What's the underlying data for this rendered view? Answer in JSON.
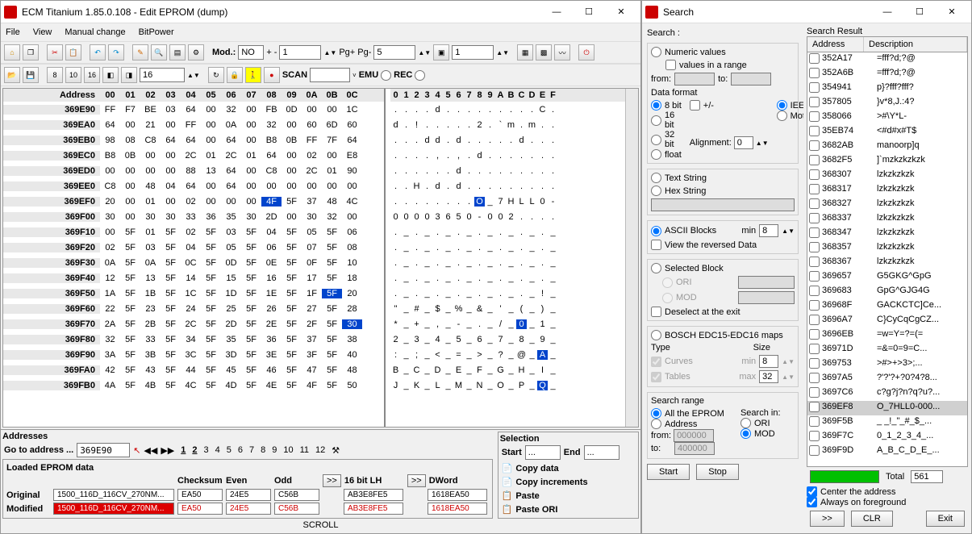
{
  "main": {
    "title": "ECM Titanium 1.85.0.108 - Edit EPROM (dump)",
    "menu": [
      "File",
      "View",
      "Manual change",
      "BitPower"
    ],
    "toolbar1": {
      "mod_label": "Mod.:",
      "mod_value": "NO",
      "plusminus": "+ -",
      "pm_value": "1",
      "pg_label": "Pg+ Pg-",
      "pg_value": "5",
      "sel_value": "1"
    },
    "toolbar2": {
      "width_value": "16",
      "scan_label": "SCAN",
      "emu_label": "EMU",
      "rec_label": "REC"
    },
    "hex": {
      "header_addr": "Address",
      "cols": [
        "00",
        "01",
        "02",
        "03",
        "04",
        "05",
        "06",
        "07",
        "08",
        "09",
        "0A",
        "0B",
        "0C"
      ],
      "ascii_cols": [
        "0",
        "1",
        "2",
        "3",
        "4",
        "5",
        "6",
        "7",
        "8",
        "9",
        "A",
        "B",
        "C",
        "D",
        "E",
        "F"
      ],
      "rows": [
        {
          "addr": "369E90",
          "b": [
            "FF",
            "F7",
            "BE",
            "03",
            "64",
            "00",
            "32",
            "00",
            "FB",
            "0D",
            "00",
            "00",
            "1C"
          ],
          "a": [
            "",
            "",
            "",
            "",
            "d",
            "",
            ".",
            "",
            "",
            "",
            "",
            "",
            "",
            "",
            "C",
            ""
          ]
        },
        {
          "addr": "369EA0",
          "b": [
            "64",
            "00",
            "21",
            "00",
            "FF",
            "00",
            "0A",
            "00",
            "32",
            "00",
            "60",
            "6D",
            "60"
          ],
          "a": [
            "d",
            "",
            "!",
            "",
            "",
            "",
            "",
            "",
            "2",
            "",
            "`",
            "m",
            "",
            "m",
            "",
            ""
          ]
        },
        {
          "addr": "369EB0",
          "b": [
            "98",
            "08",
            "C8",
            "64",
            "64",
            "00",
            "64",
            "00",
            "B8",
            "0B",
            "FF",
            "7F",
            "64"
          ],
          "a": [
            "",
            "",
            "",
            "d",
            "d",
            "",
            "d",
            "",
            "",
            "",
            "",
            "",
            "d",
            "",
            "",
            ""
          ]
        },
        {
          "addr": "369EC0",
          "b": [
            "B8",
            "0B",
            "00",
            "00",
            "2C",
            "01",
            "2C",
            "01",
            "64",
            "00",
            "02",
            "00",
            "E8"
          ],
          "a": [
            "",
            "",
            "",
            "",
            ",",
            "",
            ",",
            "",
            "d",
            "",
            "",
            "",
            "",
            "",
            "",
            ""
          ]
        },
        {
          "addr": "369ED0",
          "b": [
            "00",
            "00",
            "00",
            "00",
            "88",
            "13",
            "64",
            "00",
            "C8",
            "00",
            "2C",
            "01",
            "90"
          ],
          "a": [
            "",
            "",
            "",
            "",
            "",
            "",
            "d",
            "",
            "",
            "",
            "",
            "",
            "",
            "",
            "",
            ""
          ]
        },
        {
          "addr": "369EE0",
          "b": [
            "C8",
            "00",
            "48",
            "04",
            "64",
            "00",
            "64",
            "00",
            "00",
            "00",
            "00",
            "00",
            "00"
          ],
          "a": [
            "",
            "",
            "H",
            "",
            "d",
            "",
            "d",
            "",
            "",
            "",
            "",
            "",
            "",
            "",
            "",
            ""
          ]
        },
        {
          "addr": "369EF0",
          "b": [
            "20",
            "00",
            "01",
            "00",
            "02",
            "00",
            "00",
            "00",
            "4F",
            "5F",
            "37",
            "48",
            "4C"
          ],
          "a": [
            "",
            "",
            "",
            "",
            "",
            "",
            "",
            "",
            "O",
            "_",
            "7",
            "H",
            "L",
            "L",
            "0",
            "-"
          ],
          "sel_hex": 8,
          "sel_ascii": 8
        },
        {
          "addr": "369F00",
          "b": [
            "30",
            "00",
            "30",
            "30",
            "33",
            "36",
            "35",
            "30",
            "2D",
            "00",
            "30",
            "32",
            "00"
          ],
          "a": [
            "0",
            "0",
            "0",
            "0",
            "3",
            "6",
            "5",
            "0",
            "-",
            "0",
            "0",
            "2",
            "",
            "",
            "",
            ""
          ]
        },
        {
          "addr": "369F10",
          "b": [
            "00",
            "5F",
            "01",
            "5F",
            "02",
            "5F",
            "03",
            "5F",
            "04",
            "5F",
            "05",
            "5F",
            "06"
          ],
          "a": [
            "",
            "_",
            "",
            "_",
            "",
            "_",
            "",
            "_",
            "",
            "_",
            "",
            "_",
            "",
            "_",
            "",
            "_"
          ]
        },
        {
          "addr": "369F20",
          "b": [
            "02",
            "5F",
            "03",
            "5F",
            "04",
            "5F",
            "05",
            "5F",
            "06",
            "5F",
            "07",
            "5F",
            "08"
          ],
          "a": [
            "",
            "_",
            "",
            "_",
            "",
            "_",
            "",
            "_",
            "",
            "_",
            "",
            "_",
            "",
            "_",
            "",
            "_"
          ]
        },
        {
          "addr": "369F30",
          "b": [
            "0A",
            "5F",
            "0A",
            "5F",
            "0C",
            "5F",
            "0D",
            "5F",
            "0E",
            "5F",
            "0F",
            "5F",
            "10"
          ],
          "a": [
            "",
            "_",
            "",
            "_",
            "",
            "_",
            "",
            "_",
            "",
            "_",
            "",
            "_",
            "",
            "_",
            "",
            "_"
          ]
        },
        {
          "addr": "369F40",
          "b": [
            "12",
            "5F",
            "13",
            "5F",
            "14",
            "5F",
            "15",
            "5F",
            "16",
            "5F",
            "17",
            "5F",
            "18"
          ],
          "a": [
            "",
            "_",
            "",
            "_",
            "",
            "_",
            "",
            "_",
            "",
            "_",
            "",
            "_",
            "",
            "_",
            "",
            "_"
          ]
        },
        {
          "addr": "369F50",
          "b": [
            "1A",
            "5F",
            "1B",
            "5F",
            "1C",
            "5F",
            "1D",
            "5F",
            "1E",
            "5F",
            "1F",
            "5F",
            "20"
          ],
          "a": [
            "",
            "_",
            "",
            "_",
            "",
            "_",
            "",
            "_",
            "",
            "_",
            "",
            "_",
            "",
            "_",
            "!",
            "_"
          ],
          "sel_hex": 11
        },
        {
          "addr": "369F60",
          "b": [
            "22",
            "5F",
            "23",
            "5F",
            "24",
            "5F",
            "25",
            "5F",
            "26",
            "5F",
            "27",
            "5F",
            "28"
          ],
          "a": [
            "\"",
            "_",
            "#",
            "_",
            "$",
            "_",
            "%",
            "_",
            "&",
            "_",
            "'",
            "_",
            "(",
            "_",
            ")",
            "_"
          ]
        },
        {
          "addr": "369F70",
          "b": [
            "2A",
            "5F",
            "2B",
            "5F",
            "2C",
            "5F",
            "2D",
            "5F",
            "2E",
            "5F",
            "2F",
            "5F",
            "30"
          ],
          "a": [
            "*",
            "_",
            "+",
            "_",
            ",",
            "_",
            "-",
            "_",
            ".",
            "_",
            "/",
            "_",
            "0",
            "_",
            "1",
            "_"
          ],
          "sel_hex": 12,
          "sel_ascii": 12
        },
        {
          "addr": "369F80",
          "b": [
            "32",
            "5F",
            "33",
            "5F",
            "34",
            "5F",
            "35",
            "5F",
            "36",
            "5F",
            "37",
            "5F",
            "38"
          ],
          "a": [
            "2",
            "_",
            "3",
            "_",
            "4",
            "_",
            "5",
            "_",
            "6",
            "_",
            "7",
            "_",
            "8",
            "_",
            "9",
            "_"
          ]
        },
        {
          "addr": "369F90",
          "b": [
            "3A",
            "5F",
            "3B",
            "5F",
            "3C",
            "5F",
            "3D",
            "5F",
            "3E",
            "5F",
            "3F",
            "5F",
            "40"
          ],
          "a": [
            ":",
            "_",
            ";",
            "_",
            "<",
            "_",
            "=",
            "_",
            ">",
            "_",
            "?",
            "_",
            "@",
            "_",
            "A",
            "_"
          ],
          "sel_ascii": 14
        },
        {
          "addr": "369FA0",
          "b": [
            "42",
            "5F",
            "43",
            "5F",
            "44",
            "5F",
            "45",
            "5F",
            "46",
            "5F",
            "47",
            "5F",
            "48"
          ],
          "a": [
            "B",
            "_",
            "C",
            "_",
            "D",
            "_",
            "E",
            "_",
            "F",
            "_",
            "G",
            "_",
            "H",
            "_",
            "I",
            "_"
          ]
        },
        {
          "addr": "369FB0",
          "b": [
            "4A",
            "5F",
            "4B",
            "5F",
            "4C",
            "5F",
            "4D",
            "5F",
            "4E",
            "5F",
            "4F",
            "5F",
            "50"
          ],
          "a": [
            "J",
            "_",
            "K",
            "_",
            "L",
            "_",
            "M",
            "_",
            "N",
            "_",
            "O",
            "_",
            "P",
            "_",
            "Q",
            "_"
          ],
          "sel_ascii": 14
        }
      ]
    },
    "addresses_panel": {
      "title": "Addresses",
      "goto_label": "Go to address ...",
      "goto_value": "369E90",
      "pages": [
        "1",
        "2",
        "3",
        "4",
        "5",
        "6",
        "7",
        "8",
        "9",
        "10",
        "11",
        "12"
      ]
    },
    "eprom": {
      "title": "Loaded EPROM data",
      "headers": [
        "",
        "",
        "Checksum",
        "Even",
        "Odd",
        "",
        "16 bit LH",
        "",
        "DWord"
      ],
      "arrow": ">>",
      "original_lbl": "Original",
      "modified_lbl": "Modified",
      "name": "1500_116D_116CV_270NM...",
      "checksum": "EA50",
      "even": "24E5",
      "odd": "C56B",
      "lh": "AB3E8FE5",
      "dword": "1618EA50"
    },
    "selection": {
      "title": "Selection",
      "start_lbl": "Start",
      "start_val": "...",
      "end_lbl": "End",
      "end_val": "...",
      "copy_data": "Copy data",
      "copy_inc": "Copy increments",
      "paste": "Paste",
      "paste_ori": "Paste ORI"
    },
    "status": "SCROLL"
  },
  "search": {
    "title": "Search",
    "search_lbl": "Search :",
    "numeric": "Numeric values",
    "values_range": "values in a range",
    "from_lbl": "from:",
    "to_lbl": "to:",
    "data_format_lbl": "Data format",
    "fmt_8": "8 bit",
    "fmt_16": "16 bit",
    "fmt_32": "32 bit",
    "fmt_float": "float",
    "fmt_pm": "+/-",
    "fmt_ieee": "IEEE",
    "fmt_mot": "Motorola",
    "align_lbl": "Alignment:",
    "align_val": "0",
    "text_string": "Text String",
    "hex_string": "Hex String",
    "ascii_blocks": "ASCII Blocks",
    "min_lbl": "min",
    "min_val": "8",
    "view_reversed": "View the reversed Data",
    "selected_block": "Selected Block",
    "ori": "ORI",
    "mod": "MOD",
    "deselect": "Deselect at the exit",
    "bosch": "BOSCH EDC15-EDC16 maps",
    "type_lbl": "Type",
    "size_lbl": "Size",
    "curves": "Curves",
    "tables": "Tables",
    "size_min": "8",
    "max_lbl": "max",
    "size_max": "32",
    "range_lbl": "Search range",
    "all_eprom": "All the EPROM",
    "address_r": "Address",
    "r_from": "000000",
    "r_to": "400000",
    "search_in_lbl": "Search in:",
    "start_btn": "Start",
    "stop_btn": "Stop",
    "result_title": "Search Result",
    "col_addr": "Address",
    "col_desc": "Description",
    "results": [
      {
        "a": "352A17",
        "d": "=fff?d;?@"
      },
      {
        "a": "352A6B",
        "d": "=fff?d;?@"
      },
      {
        "a": "354941",
        "d": "p}?fff?fff?"
      },
      {
        "a": "357805",
        "d": "}v*8,J.:4?"
      },
      {
        "a": "358066",
        "d": ">#\\Y*L-"
      },
      {
        "a": "35EB74",
        "d": "<#d#x#T$"
      },
      {
        "a": "3682AB",
        "d": "manoorp]q"
      },
      {
        "a": "3682F5",
        "d": "]`mzkzkzkzk"
      },
      {
        "a": "368307",
        "d": "lzkzkzkzk"
      },
      {
        "a": "368317",
        "d": "lzkzkzkzk"
      },
      {
        "a": "368327",
        "d": "lzkzkzkzk"
      },
      {
        "a": "368337",
        "d": "lzkzkzkzk"
      },
      {
        "a": "368347",
        "d": "lzkzkzkzk"
      },
      {
        "a": "368357",
        "d": "lzkzkzkzk"
      },
      {
        "a": "368367",
        "d": "lzkzkzkzk"
      },
      {
        "a": "369657",
        "d": "G5GKG^GpG"
      },
      {
        "a": "369683",
        "d": "GpG^GJG4G"
      },
      {
        "a": "36968F",
        "d": "GACKCTC]Ce..."
      },
      {
        "a": "3696A7",
        "d": "C}CyCqCgCZ..."
      },
      {
        "a": "3696EB",
        "d": "=w=Y=?=(="
      },
      {
        "a": "36971D",
        "d": "=&=0=9=C..."
      },
      {
        "a": "369753",
        "d": ">#>+>3>;..."
      },
      {
        "a": "3697A5",
        "d": "?'?'?+?0?4?8..."
      },
      {
        "a": "3697C6",
        "d": "c?g?j?n?q?u?..."
      },
      {
        "a": "369EF8",
        "d": "O_7HLL0-000...",
        "sel": true
      },
      {
        "a": "369F5B",
        "d": "_ _!_\"_#_$_..."
      },
      {
        "a": "369F7C",
        "d": "0_1_2_3_4_..."
      },
      {
        "a": "369F9D",
        "d": "A_B_C_D_E_..."
      }
    ],
    "total_lbl": "Total",
    "total_val": "561",
    "center": "Center the address",
    "always_fg": "Always on foreground",
    "btn_go": ">>",
    "btn_clr": "CLR",
    "btn_exit": "Exit"
  }
}
